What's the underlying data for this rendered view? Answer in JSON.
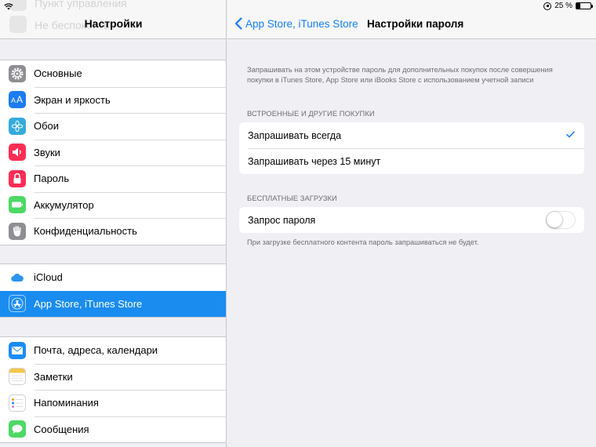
{
  "status_bar": {
    "battery_percent": "25 %",
    "battery_level": 0.25
  },
  "left_header": {
    "title": "Настройки",
    "ghost_items": [
      "Пункт управления",
      "Не беспокоить"
    ]
  },
  "sidebar": {
    "groups": [
      [
        {
          "label": "Основные",
          "icon": "gear-icon",
          "color": "#8e8e93"
        },
        {
          "label": "Экран и яркость",
          "icon": "text-size-icon",
          "color": "#1c7cf2"
        },
        {
          "label": "Обои",
          "icon": "wallpaper-flower-icon",
          "color": "#35aadc"
        },
        {
          "label": "Звуки",
          "icon": "speaker-icon",
          "color": "#fe2d55"
        },
        {
          "label": "Пароль",
          "icon": "lock-icon",
          "color": "#fe2d55"
        },
        {
          "label": "Аккумулятор",
          "icon": "battery-icon",
          "color": "#4cd964"
        },
        {
          "label": "Конфиденциальность",
          "icon": "hand-icon",
          "color": "#8e8e93"
        }
      ],
      [
        {
          "label": "iCloud",
          "icon": "cloud-icon",
          "color": "#ffffff"
        },
        {
          "label": "App Store, iTunes Store",
          "icon": "app-store-icon",
          "color": "#1c8ef9",
          "selected": true
        }
      ],
      [
        {
          "label": "Почта, адреса, календари",
          "icon": "mail-icon",
          "color": "#1a8cf5"
        },
        {
          "label": "Заметки",
          "icon": "notes-icon",
          "color": "#ffffff"
        },
        {
          "label": "Напоминания",
          "icon": "reminders-icon",
          "color": "#ffffff"
        },
        {
          "label": "Сообщения",
          "icon": "messages-icon",
          "color": "#4cd964"
        }
      ]
    ]
  },
  "right_header": {
    "back_label": "App Store, iTunes Store",
    "title": "Настройки пароля"
  },
  "main": {
    "description": "Запрашивать на этом устройстве пароль для дополнительных покупок после совершения покупки в iTunes Store, App Store или iBooks Store с использованием учетной записи",
    "purchases_header": "ВСТРОЕННЫЕ И ДРУГИЕ ПОКУПКИ",
    "purchase_options": [
      {
        "label": "Запрашивать всегда",
        "checked": true
      },
      {
        "label": "Запрашивать через 15 минут",
        "checked": false
      }
    ],
    "free_header": "БЕСПЛАТНЫЕ ЗАГРУЗКИ",
    "require_password_label": "Запрос пароля",
    "require_password_on": false,
    "free_footer": "При загрузке бесплатного контента пароль запрашиваться не будет."
  },
  "colors": {
    "accent": "#157efb",
    "selected_row": "#1a8cf0",
    "background": "#efeff4"
  }
}
